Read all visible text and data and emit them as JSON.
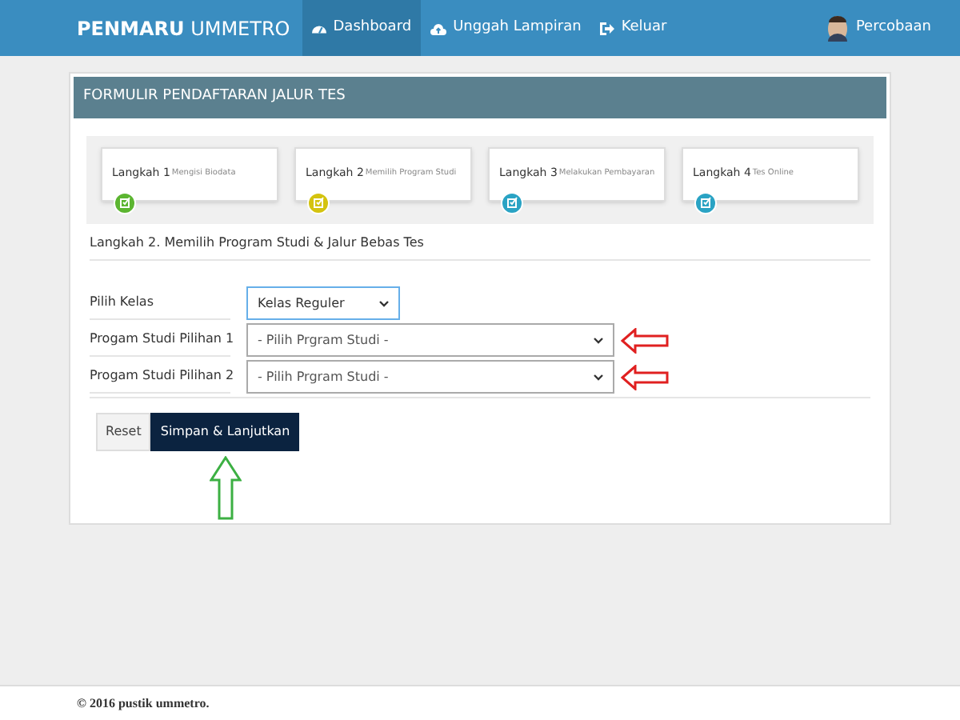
{
  "navbar": {
    "brand_bold": "PENMARU",
    "brand_light": "UMMETRO",
    "items": [
      {
        "label": "Dashboard",
        "kind": "dashboard",
        "selected": true
      },
      {
        "label": "Unggah Lampiran",
        "kind": "upload",
        "selected": false
      },
      {
        "label": "Keluar",
        "kind": "logout",
        "selected": false
      }
    ],
    "user": "Percobaan"
  },
  "panel": {
    "title": "FORMULIR PENDAFTARAN JALUR TES",
    "steps": [
      {
        "title": "Langkah 1",
        "subtitle": "Mengisi Biodata",
        "color": "#5cb531"
      },
      {
        "title": "Langkah 2",
        "subtitle": "Memilih Program Studi",
        "color": "#d4c30f"
      },
      {
        "title": "Langkah 3",
        "subtitle": "Melakukan Pembayaran",
        "color": "#2aa3c4"
      },
      {
        "title": "Langkah 4",
        "subtitle": "Tes Online",
        "color": "#2aa3c4"
      }
    ],
    "section_title": "Langkah 2. Memilih Program Studi & Jalur Bebas Tes",
    "fields": [
      {
        "label": "Pilih Kelas",
        "value": "Kelas Reguler",
        "kind": "short",
        "focused": true,
        "arrow": false
      },
      {
        "label": "Progam Studi Pilihan 1",
        "value": "- Pilih Prgram Studi -",
        "kind": "wide",
        "focused": false,
        "arrow": true
      },
      {
        "label": "Progam Studi Pilihan 2",
        "value": "- Pilih Prgram Studi -",
        "kind": "wide",
        "focused": false,
        "arrow": true
      }
    ],
    "buttons": [
      {
        "label": "Reset",
        "kind": "default"
      },
      {
        "label": "Simpan & Lanjutkan",
        "kind": "primary",
        "arrow": true
      }
    ]
  },
  "footer": "© 2016 pustik ummetro."
}
